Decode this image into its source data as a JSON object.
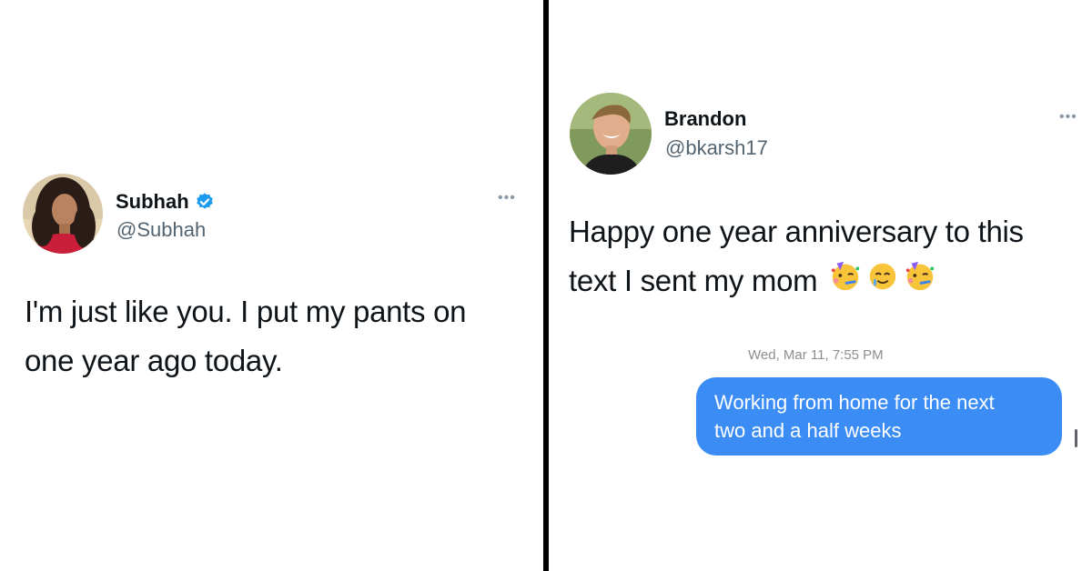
{
  "left_tweet": {
    "name": "Subhah",
    "handle": "@Subhah",
    "verified": true,
    "text_lines": [
      "I'm just like you. I put my pants on",
      "one year ago today."
    ],
    "more_icon": "ellipsis-icon",
    "verified_icon": "verified-badge-icon"
  },
  "right_tweet": {
    "name": "Brandon",
    "handle": "@bkarsh17",
    "text_lines": [
      "Happy one year anniversary to this",
      "text I sent my mom"
    ],
    "emojis": [
      "partying-face-emoji",
      "smiling-face-with-tear-emoji",
      "partying-face-emoji"
    ],
    "more_icon": "ellipsis-icon",
    "message": {
      "timestamp": "Wed, Mar 11, 7:55 PM",
      "bubble_lines": [
        "Working from home for the next",
        "two and a half weeks"
      ]
    }
  },
  "colors": {
    "divider": "#000000",
    "verified_blue": "#1d9bf0",
    "imessage_blue": "#3b8df5",
    "handle_gray": "#536471"
  }
}
